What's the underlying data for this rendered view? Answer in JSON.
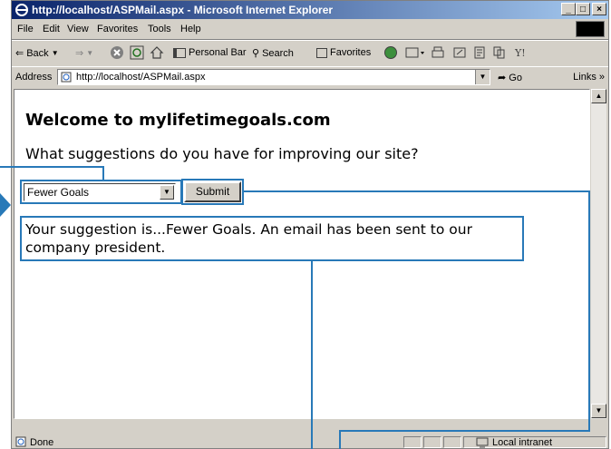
{
  "window": {
    "title": "http://localhost/ASPMail.aspx - Microsoft Internet Explorer",
    "minimize": "_",
    "maximize": "□",
    "close": "×"
  },
  "menu": [
    "File",
    "Edit",
    "View",
    "Favorites",
    "Tools",
    "Help"
  ],
  "toolbar": {
    "back": "Back",
    "personal_bar": "Personal Bar",
    "search": "Search",
    "favorites": "Favorites"
  },
  "address": {
    "label": "Address",
    "url": "http://localhost/ASPMail.aspx",
    "go": "Go",
    "links": "Links »"
  },
  "page": {
    "heading": "Welcome to mylifetimegoals.com",
    "question": "What suggestions do you have for improving our site?",
    "select_value": "Fewer Goals",
    "submit_label": "Submit",
    "result": "Your suggestion is...Fewer Goals. An email has been sent to our company president."
  },
  "status": {
    "text": "Done",
    "zone": "Local intranet"
  },
  "colors": {
    "callout": "#2879b8",
    "titlebar_start": "#0a246a",
    "titlebar_end": "#a6caf0"
  }
}
